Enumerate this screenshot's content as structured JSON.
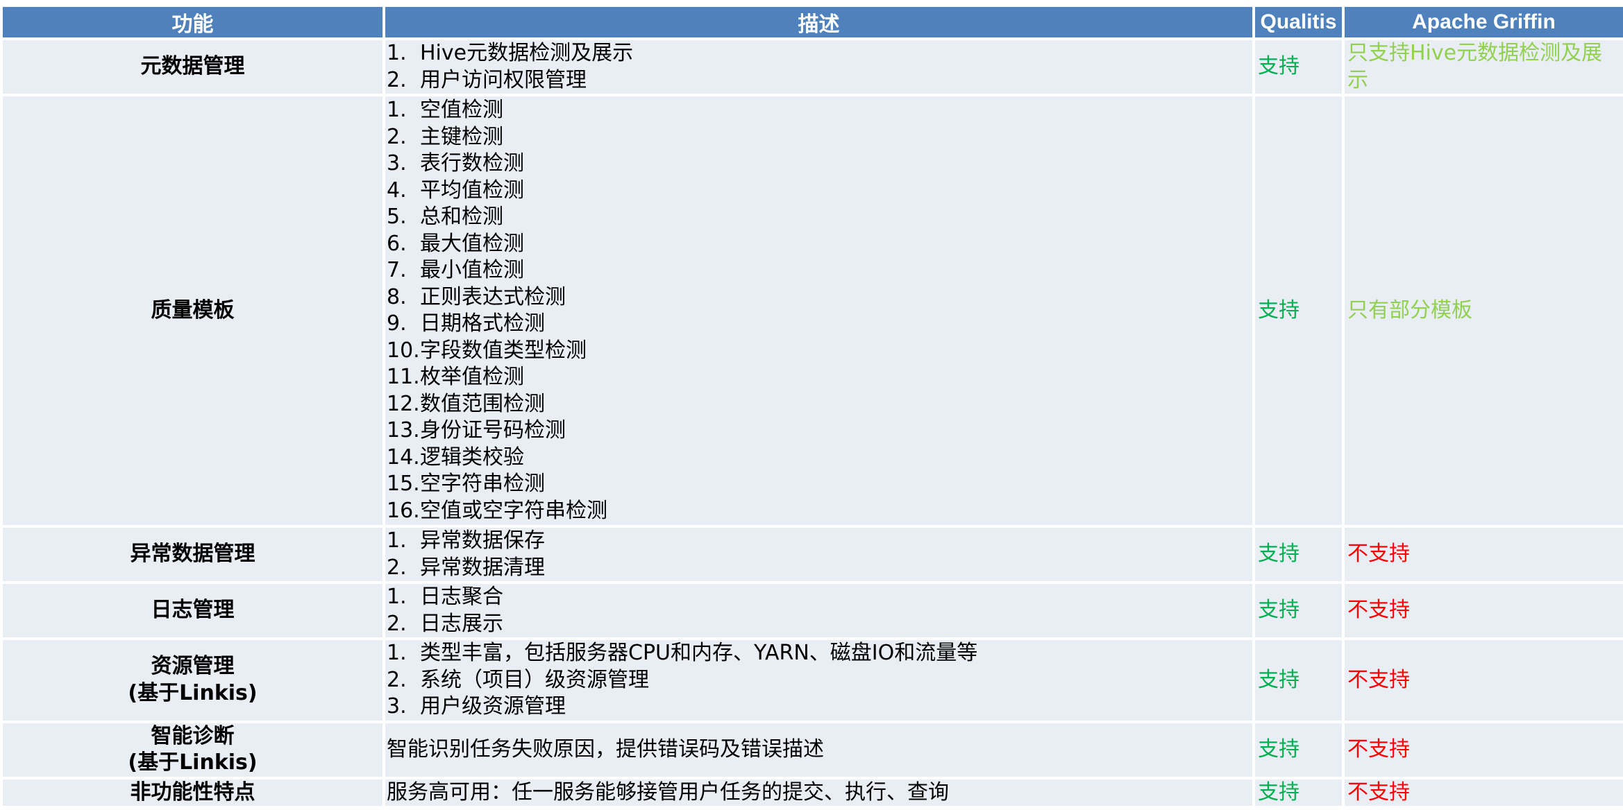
{
  "headers": {
    "feature": "功能",
    "description": "描述",
    "qualitis": "Qualitis",
    "griffin": "Apache Griffin"
  },
  "rows": [
    {
      "feature": [
        "元数据管理"
      ],
      "items": [
        {
          "n": "1.",
          "t": "Hive元数据检测及展示"
        },
        {
          "n": "2.",
          "t": "用户访问权限管理"
        }
      ],
      "qualitis": "支持",
      "griffin": "只支持Hive元数据检测及展示"
    },
    {
      "feature": [
        "质量模板"
      ],
      "items": [
        {
          "n": "1.",
          "t": "空值检测"
        },
        {
          "n": "2.",
          "t": "主键检测"
        },
        {
          "n": "3.",
          "t": "表行数检测"
        },
        {
          "n": "4.",
          "t": "平均值检测"
        },
        {
          "n": "5.",
          "t": "总和检测"
        },
        {
          "n": "6.",
          "t": "最大值检测"
        },
        {
          "n": "7.",
          "t": "最小值检测"
        },
        {
          "n": "8.",
          "t": "正则表达式检测"
        },
        {
          "n": "9.",
          "t": "日期格式检测"
        },
        {
          "n": "10.",
          "t": "字段数值类型检测"
        },
        {
          "n": "11.",
          "t": "枚举值检测"
        },
        {
          "n": "12.",
          "t": "数值范围检测"
        },
        {
          "n": "13.",
          "t": "身份证号码检测"
        },
        {
          "n": "14.",
          "t": "逻辑类校验"
        },
        {
          "n": "15.",
          "t": "空字符串检测"
        },
        {
          "n": "16.",
          "t": "空值或空字符串检测"
        }
      ],
      "qualitis": "支持",
      "griffin": "只有部分模板"
    },
    {
      "feature": [
        "异常数据管理"
      ],
      "items": [
        {
          "n": "1.",
          "t": "异常数据保存"
        },
        {
          "n": "2.",
          "t": "异常数据清理"
        }
      ],
      "qualitis": "支持",
      "griffin": "不支持"
    },
    {
      "feature": [
        "日志管理"
      ],
      "items": [
        {
          "n": "1.",
          "t": "日志聚合"
        },
        {
          "n": "2.",
          "t": "日志展示"
        }
      ],
      "qualitis": "支持",
      "griffin": "不支持"
    },
    {
      "feature": [
        "资源管理",
        "(基于Linkis)"
      ],
      "items": [
        {
          "n": "1.",
          "t": "类型丰富，包括服务器CPU和内存、YARN、磁盘IO和流量等"
        },
        {
          "n": "2.",
          "t": "系统（项目）级资源管理"
        },
        {
          "n": "3.",
          "t": "用户级资源管理"
        }
      ],
      "qualitis": "支持",
      "griffin": "不支持"
    },
    {
      "feature": [
        "智能诊断",
        "(基于Linkis)"
      ],
      "text": "智能识别任务失败原因，提供错误码及错误描述",
      "qualitis": "支持",
      "griffin": "不支持"
    },
    {
      "feature": [
        "非功能性特点"
      ],
      "text": "服务高可用：任一服务能够接管用户任务的提交、执行、查询",
      "qualitis": "支持",
      "griffin": "不支持"
    }
  ],
  "colors": {
    "header_bg": "#4f81bd",
    "row_bg": "#e9edf4",
    "supported": "#00b050",
    "partial": "#92d050",
    "unsupported": "#ff0000"
  }
}
